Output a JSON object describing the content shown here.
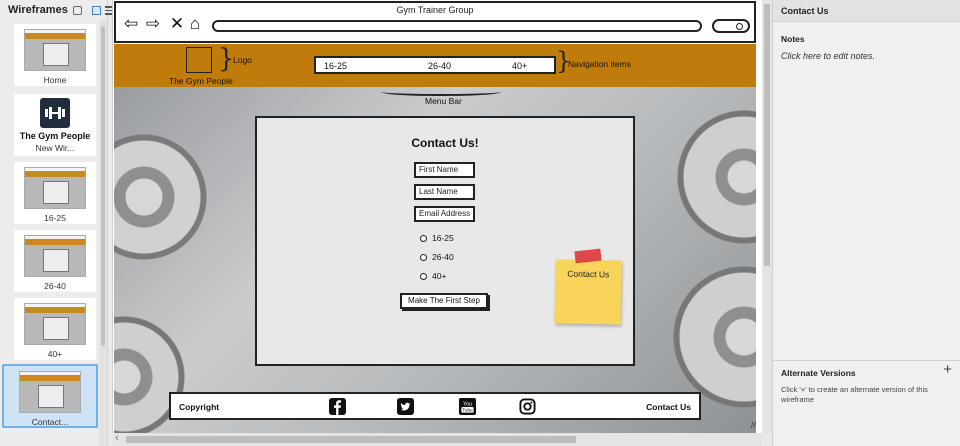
{
  "sidebar": {
    "title": "Wireframes",
    "items": [
      {
        "label": "Home"
      },
      {
        "label": "New Wir...",
        "logo_text": "The Gym People"
      },
      {
        "label": "16-25"
      },
      {
        "label": "26-40"
      },
      {
        "label": "40+"
      },
      {
        "label": "Contact..."
      }
    ],
    "selected": "Contact..."
  },
  "browser": {
    "title": "Gym Trainer Group",
    "nav_icons": [
      "back-arrow-icon",
      "forward-arrow-icon",
      "close-x-icon",
      "home-icon"
    ]
  },
  "site": {
    "logo_label": "Logo",
    "brand": "The Gym People",
    "nav_items": [
      "16-25",
      "26-40",
      "40+"
    ],
    "nav_label": "Navigation items",
    "menu_bar_label": "Menu Bar",
    "header_color": "#c07c0a"
  },
  "form": {
    "title": "Contact Us!",
    "fields": [
      "First Name",
      "Last Name",
      "Email Address"
    ],
    "radios": [
      "16-25",
      "26-40",
      "40+"
    ],
    "submit": "Make The First Step"
  },
  "sticky_note": {
    "text": "Contact Us",
    "color": "#f8d45a",
    "tape_color": "#e04848"
  },
  "footer": {
    "copyright": "Copyright",
    "contact": "Contact Us",
    "social_icons": [
      "facebook-icon",
      "twitter-icon",
      "youtube-icon",
      "instagram-icon"
    ]
  },
  "right_panel": {
    "title": "Contact Us",
    "notes_heading": "Notes",
    "notes_placeholder": "Click here to edit notes.",
    "alt_heading": "Alternate Versions",
    "alt_add": "+",
    "alt_help": "Click '+' to create an alternate version of this wireframe"
  }
}
